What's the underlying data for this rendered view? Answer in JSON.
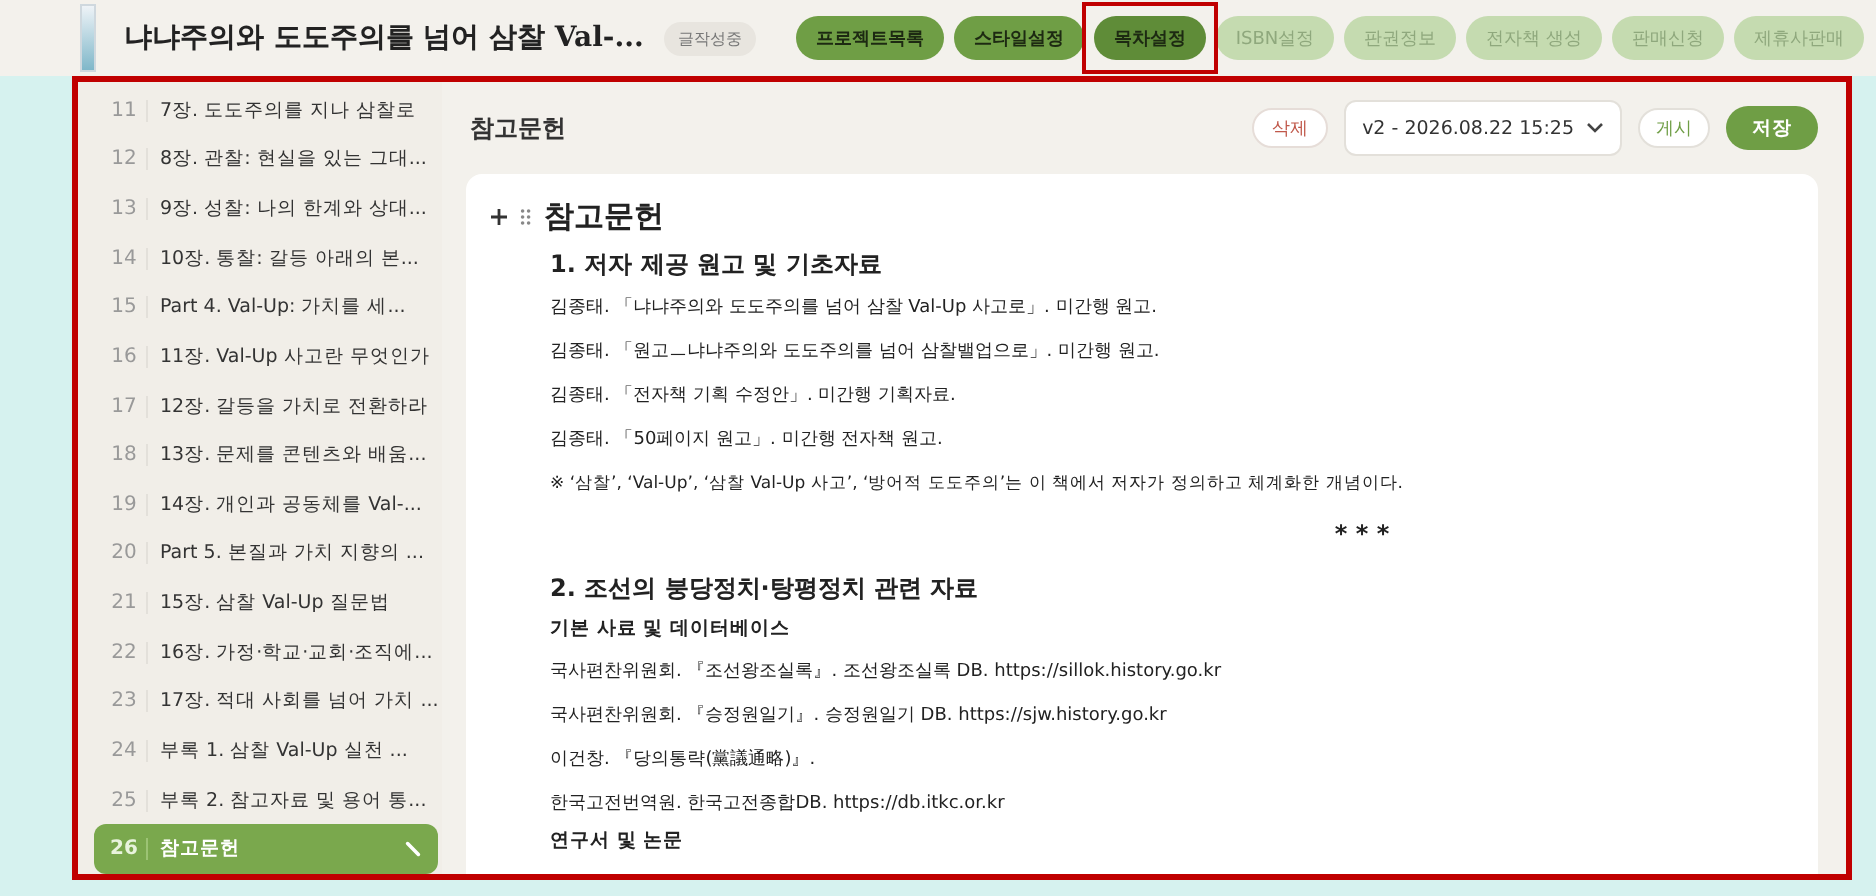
{
  "book": {
    "title": "냐냐주의와 도도주의를 넘어 삼찰 Val-...",
    "status": "글작성중"
  },
  "nav": [
    {
      "label": "프로젝트목록",
      "selected": false,
      "disabled": false
    },
    {
      "label": "스타일설정",
      "selected": false,
      "disabled": false
    },
    {
      "label": "목차설정",
      "selected": true,
      "disabled": false
    },
    {
      "label": "ISBN설정",
      "selected": false,
      "disabled": true
    },
    {
      "label": "판권정보",
      "selected": false,
      "disabled": true
    },
    {
      "label": "전자책 생성",
      "selected": false,
      "disabled": true
    },
    {
      "label": "판매신청",
      "selected": false,
      "disabled": true
    },
    {
      "label": "제휴사판매",
      "selected": false,
      "disabled": true
    }
  ],
  "toc": [
    {
      "number": "11",
      "label": "7장. 도도주의를 지나 삼찰로",
      "selected": false
    },
    {
      "number": "12",
      "label": "8장. 관찰: 현실을 있는 그대...",
      "selected": false
    },
    {
      "number": "13",
      "label": "9장. 성찰: 나의 한계와 상대...",
      "selected": false
    },
    {
      "number": "14",
      "label": "10장. 통찰: 갈등 아래의 본...",
      "selected": false
    },
    {
      "number": "15",
      "label": "Part 4. Val-Up: 가치를 세...",
      "selected": false
    },
    {
      "number": "16",
      "label": "11장. Val-Up 사고란 무엇인가",
      "selected": false
    },
    {
      "number": "17",
      "label": "12장. 갈등을 가치로 전환하라",
      "selected": false
    },
    {
      "number": "18",
      "label": "13장. 문제를 콘텐츠와 배움...",
      "selected": false
    },
    {
      "number": "19",
      "label": "14장. 개인과 공동체를 Val-...",
      "selected": false
    },
    {
      "number": "20",
      "label": "Part 5. 본질과 가치 지향의 ...",
      "selected": false
    },
    {
      "number": "21",
      "label": "15장. 삼찰 Val-Up 질문법",
      "selected": false
    },
    {
      "number": "22",
      "label": "16장. 가정·학교·교회·조직에...",
      "selected": false
    },
    {
      "number": "23",
      "label": "17장. 적대 사회를 넘어 가치 ...",
      "selected": false
    },
    {
      "number": "24",
      "label": "부록 1. 삼찰 Val-Up 실천 ...",
      "selected": false
    },
    {
      "number": "25",
      "label": "부록 2. 참고자료 및 용어 통...",
      "selected": false
    },
    {
      "number": "26",
      "label": "참고문헌",
      "selected": true
    }
  ],
  "editor": {
    "title": "참고문헌",
    "delete": "삭제",
    "version": "v2 - 2026.08.22 15:25",
    "publish": "게시",
    "save": "저장",
    "blocks": [
      {
        "kind": "h1",
        "text": "참고문헌"
      },
      {
        "kind": "h2",
        "text": "1. 저자 제공 원고 및 기초자료"
      },
      {
        "kind": "p",
        "text": "김종태. 「냐냐주의와 도도주의를 넘어 삼찰 Val-Up 사고로」. 미간행 원고."
      },
      {
        "kind": "p",
        "text": "김종태. 「원고ㅡ냐냐주의와 도도주의를 넘어 삼찰밸업으로」. 미간행 원고."
      },
      {
        "kind": "p",
        "text": "김종태. 「전자책 기획 수정안」. 미간행 기획자료."
      },
      {
        "kind": "p",
        "text": "김종태. 「50페이지 원고」. 미간행 전자책 원고."
      },
      {
        "kind": "note",
        "text": "※ ‘삼찰’, ‘Val-Up’, ‘삼찰 Val-Up 사고’, ‘방어적 도도주의’는 이 책에서 저자가 정의하고 체계화한 개념이다."
      },
      {
        "kind": "separator",
        "text": "* * *"
      },
      {
        "kind": "h2",
        "text": "2. 조선의 붕당정치·탕평정치 관련 자료"
      },
      {
        "kind": "h3",
        "text": "기본 사료 및 데이터베이스"
      },
      {
        "kind": "p",
        "text": "국사편찬위원회. 『조선왕조실록』. 조선왕조실록 DB. https://sillok.history.go.kr"
      },
      {
        "kind": "p",
        "text": "국사편찬위원회. 『승정원일기』. 승정원일기 DB. https://sjw.history.go.kr"
      },
      {
        "kind": "p",
        "text": "이건창. 『당의통략(黨議通略)』."
      },
      {
        "kind": "p",
        "text": "한국고전번역원. 한국고전종합DB. https://db.itkc.or.kr"
      },
      {
        "kind": "h3",
        "text": "연구서 및 논문"
      }
    ]
  }
}
